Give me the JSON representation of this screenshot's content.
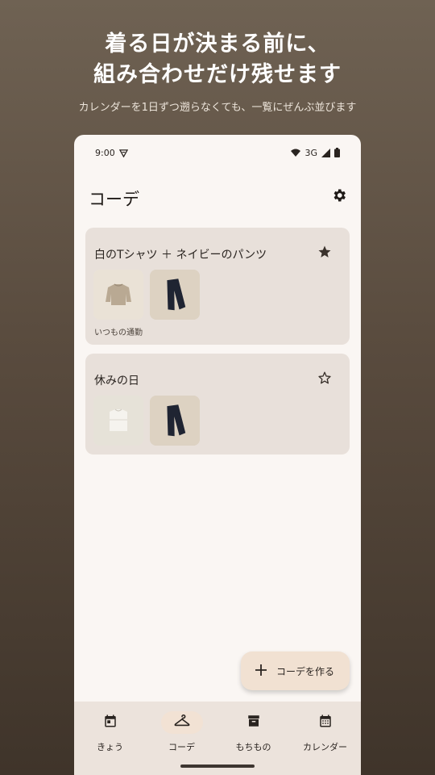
{
  "promo": {
    "title_line1": "着る日が決まる前に、",
    "title_line2": "組み合わせだけ残せます",
    "subtitle": "カレンダーを1日ずつ遡らなくても、一覧にぜんぶ並びます"
  },
  "status_bar": {
    "time": "9:00",
    "network": "3G"
  },
  "header": {
    "title": "コーデ"
  },
  "outfits": [
    {
      "title": "白のTシャツ ＋ ネイビーのパンツ",
      "favorite": true,
      "note": "いつもの通勤",
      "items": [
        "beige-sweater",
        "navy-pants"
      ]
    },
    {
      "title": "休みの日",
      "favorite": false,
      "note": "",
      "items": [
        "white-tshirt",
        "navy-pants"
      ]
    }
  ],
  "fab": {
    "label": "コーデを作る"
  },
  "bottom_nav": {
    "items": [
      {
        "label": "きょう",
        "icon": "calendar-today-icon",
        "active": false
      },
      {
        "label": "コーデ",
        "icon": "hanger-icon",
        "active": true
      },
      {
        "label": "もちもの",
        "icon": "archive-box-icon",
        "active": false
      },
      {
        "label": "カレンダー",
        "icon": "calendar-month-icon",
        "active": false
      }
    ]
  },
  "colors": {
    "background_top": "#6f6253",
    "background_bottom": "#3f342a",
    "screen": "#faf6f3",
    "card": "#e8e0da",
    "fab": "#f1e1d2",
    "nav": "#ece3dc",
    "text": "#2a2420"
  }
}
